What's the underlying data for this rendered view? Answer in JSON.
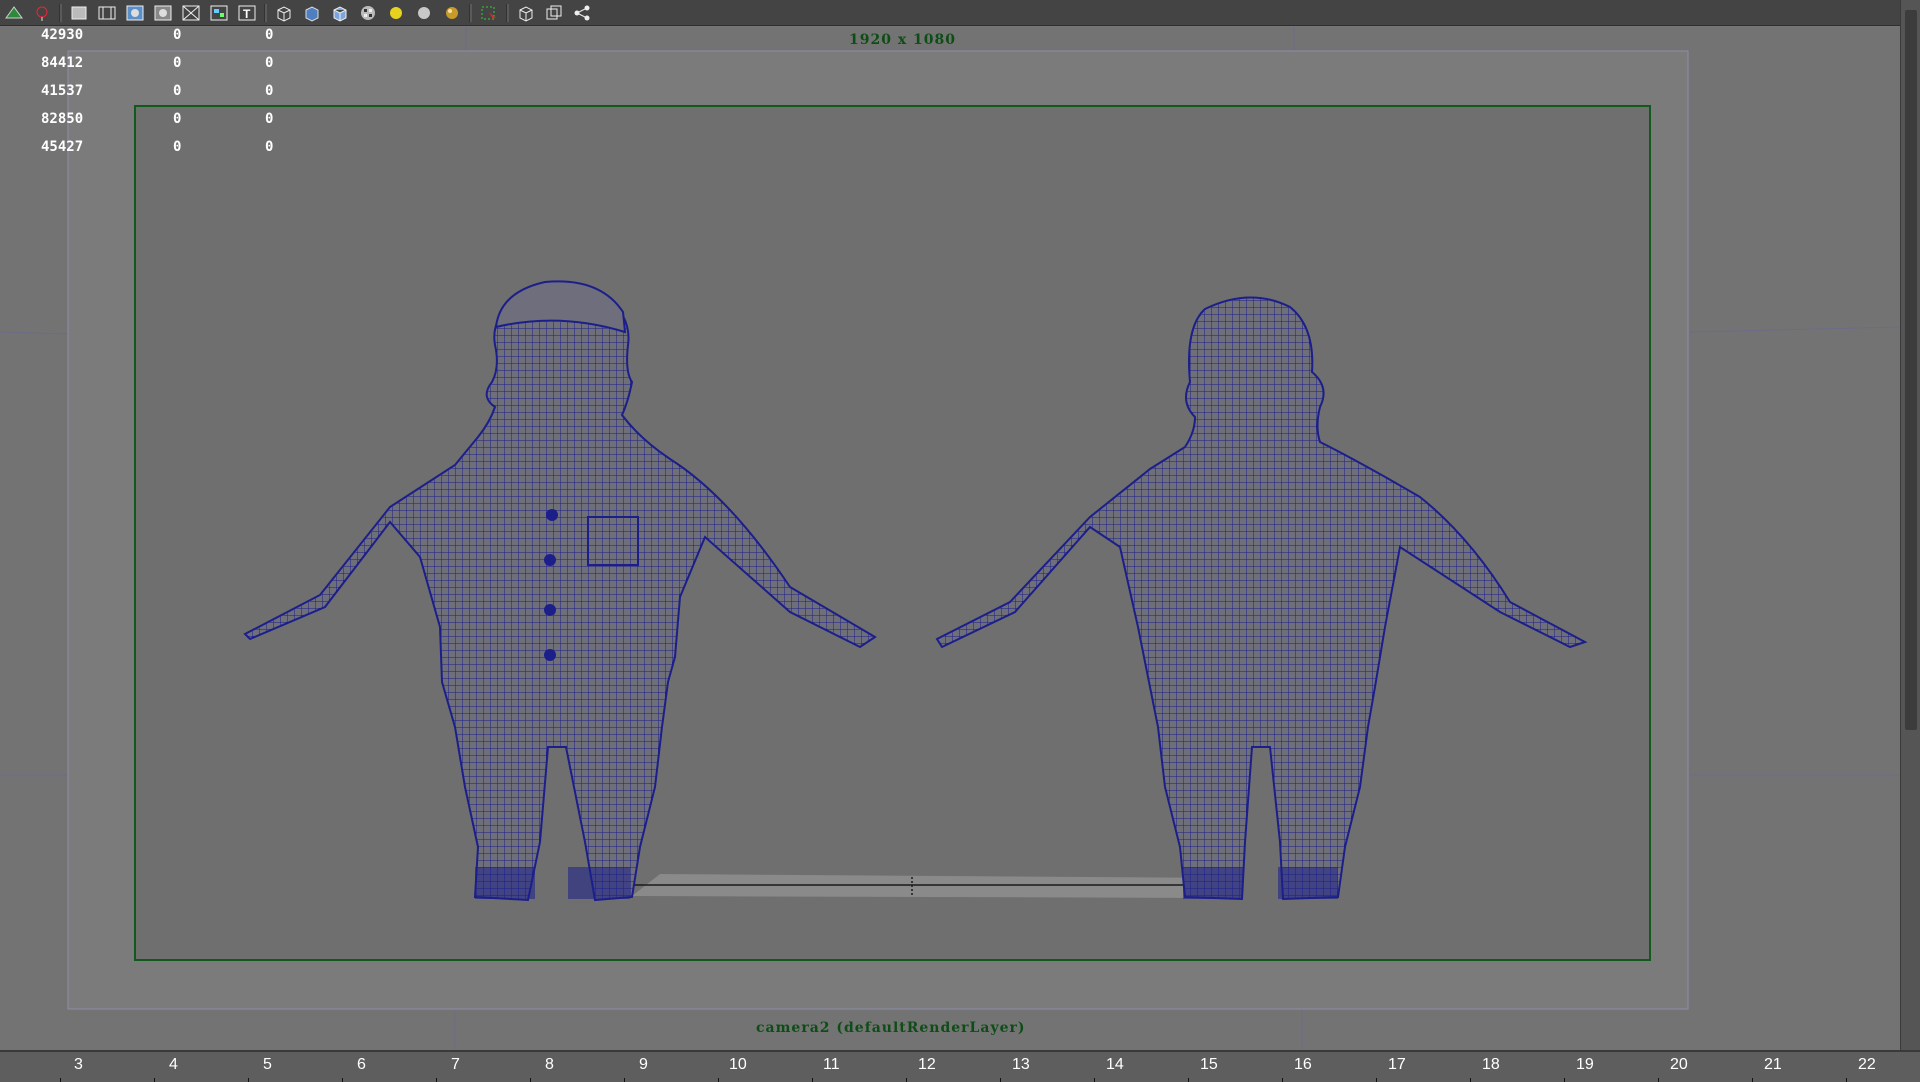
{
  "toolbar": {
    "icons": [
      "camera-attributes-icon",
      "bookmark-icon",
      "grid-icon",
      "film-gate-icon",
      "resolution-gate-icon",
      "gate-mask-icon",
      "field-chart-icon",
      "safe-action-icon",
      "safe-title-icon",
      "wireframe-icon",
      "smooth-shade-icon",
      "wireframe-on-shaded-icon",
      "textured-icon",
      "default-light-icon",
      "all-lights-icon",
      "shadows-icon",
      "isolate-select-icon",
      "xray-icon",
      "xray-joints-icon",
      "share-icon"
    ]
  },
  "hud": {
    "rows": [
      {
        "a": "42930",
        "b": "0",
        "c": "0"
      },
      {
        "a": "84412",
        "b": "0",
        "c": "0"
      },
      {
        "a": "41537",
        "b": "0",
        "c": "0"
      },
      {
        "a": "82850",
        "b": "0",
        "c": "0"
      },
      {
        "a": "45427",
        "b": "0",
        "c": "0"
      }
    ]
  },
  "viewport": {
    "resolution_label": "1920 x 1080",
    "camera_label": "camera2 (defaultRenderLayer)",
    "gate_color": "#0f5a1c",
    "mesh_color": "#1c1f8a"
  },
  "timeline": {
    "ticks": [
      "3",
      "4",
      "5",
      "6",
      "7",
      "8",
      "9",
      "10",
      "11",
      "12",
      "13",
      "14",
      "15",
      "16",
      "17",
      "18",
      "19",
      "20",
      "21",
      "22"
    ]
  }
}
